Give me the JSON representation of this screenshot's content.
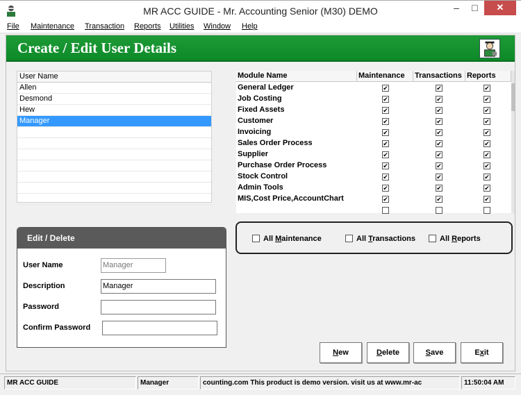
{
  "window": {
    "title": "MR ACC GUIDE - Mr. Accounting Senior (M30) DEMO",
    "minimize_glyph": "–",
    "maximize_glyph": "□",
    "close_glyph": "✕"
  },
  "menu": [
    "File",
    "Maintenance",
    "Transaction",
    "Reports",
    "Utilities",
    "Window",
    "Help"
  ],
  "banner": {
    "title": "Create / Edit User Details",
    "icon": "user-icon"
  },
  "users": {
    "header": "User Name",
    "rows": [
      "Allen",
      "Desmond",
      "Hew",
      "Manager",
      "",
      "",
      "",
      "",
      "",
      "",
      ""
    ],
    "selected": "Manager"
  },
  "modules": {
    "headers": [
      "Module Name",
      "Maintenance",
      "Transactions",
      "Reports"
    ],
    "rows": [
      {
        "name": "General Ledger",
        "maintenance": true,
        "transactions": true,
        "reports": true
      },
      {
        "name": "Job Costing",
        "maintenance": true,
        "transactions": true,
        "reports": true
      },
      {
        "name": "Fixed Assets",
        "maintenance": true,
        "transactions": true,
        "reports": true
      },
      {
        "name": "Customer",
        "maintenance": true,
        "transactions": true,
        "reports": true
      },
      {
        "name": "Invoicing",
        "maintenance": true,
        "transactions": true,
        "reports": true
      },
      {
        "name": "Sales Order Process",
        "maintenance": true,
        "transactions": true,
        "reports": true
      },
      {
        "name": "Supplier",
        "maintenance": true,
        "transactions": true,
        "reports": true
      },
      {
        "name": "Purchase Order Process",
        "maintenance": true,
        "transactions": true,
        "reports": true
      },
      {
        "name": "Stock Control",
        "maintenance": true,
        "transactions": true,
        "reports": true
      },
      {
        "name": "Admin Tools",
        "maintenance": true,
        "transactions": true,
        "reports": true
      },
      {
        "name": "MIS,Cost Price,AccountChart",
        "maintenance": true,
        "transactions": true,
        "reports": true
      },
      {
        "name": "",
        "maintenance": false,
        "transactions": false,
        "reports": false
      }
    ]
  },
  "edit_panel": {
    "title": "Edit / Delete",
    "user_name_label": "User Name",
    "user_name_value": "Manager",
    "description_label": "Description",
    "description_value": "Manager",
    "password_label": "Password",
    "password_value": "",
    "confirm_label": "Confirm Password",
    "confirm_value": ""
  },
  "all_options": {
    "maintenance_pre": "All ",
    "maintenance_key": "M",
    "maintenance_post": "aintenance",
    "transactions_pre": "All ",
    "transactions_key": "T",
    "transactions_post": "ransactions",
    "reports_pre": "All ",
    "reports_key": "R",
    "reports_post": "eports"
  },
  "buttons": {
    "new_key": "N",
    "new_rest": "ew",
    "delete_key": "D",
    "delete_rest": "elete",
    "save_key": "S",
    "save_rest": "ave",
    "exit_pre": "E",
    "exit_key": "x",
    "exit_rest": "it"
  },
  "status": {
    "app": "MR ACC GUIDE",
    "user": "Manager",
    "message": "counting.com This product is demo version.  visit us at www.mr-ac",
    "time": "11:50:04 AM"
  },
  "colors": {
    "banner": "#1e9a36",
    "selection": "#3399ff",
    "close": "#c74c4c",
    "edit_header": "#5a5a5a"
  }
}
